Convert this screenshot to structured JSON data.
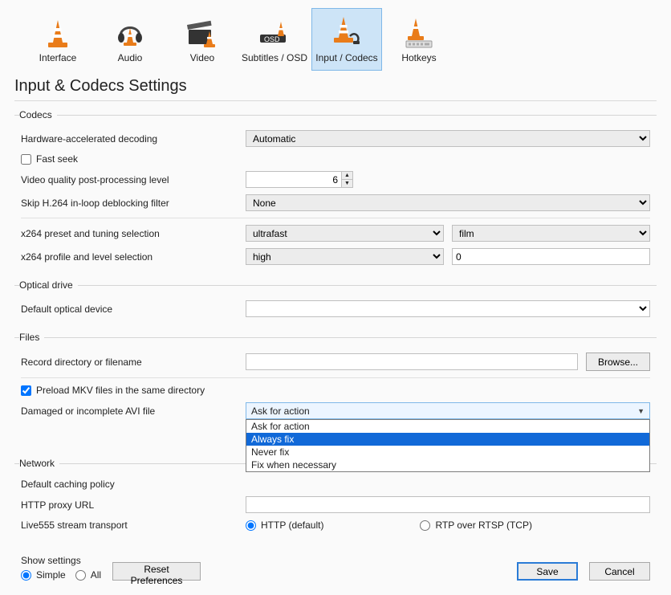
{
  "tabs": {
    "interface": "Interface",
    "audio": "Audio",
    "video": "Video",
    "subtitles": "Subtitles / OSD",
    "input_codecs": "Input / Codecs",
    "hotkeys": "Hotkeys"
  },
  "page_title": "Input & Codecs Settings",
  "groups": {
    "codecs": {
      "legend": "Codecs",
      "hw_decoding_label": "Hardware-accelerated decoding",
      "hw_decoding_value": "Automatic",
      "fast_seek_label": "Fast seek",
      "fast_seek_checked": false,
      "postproc_label": "Video quality post-processing level",
      "postproc_value": "6",
      "skip_h264_label": "Skip H.264 in-loop deblocking filter",
      "skip_h264_value": "None",
      "x264_preset_label": "x264 preset and tuning selection",
      "x264_preset_value": "ultrafast",
      "x264_tune_value": "film",
      "x264_profile_label": "x264 profile and level selection",
      "x264_profile_value": "high",
      "x264_level_value": "0"
    },
    "optical": {
      "legend": "Optical drive",
      "default_device_label": "Default optical device",
      "default_device_value": ""
    },
    "files": {
      "legend": "Files",
      "record_dir_label": "Record directory or filename",
      "record_dir_value": "",
      "browse_label": "Browse...",
      "preload_mkv_label": "Preload MKV files in the same directory",
      "preload_mkv_checked": true,
      "avi_label": "Damaged or incomplete AVI file",
      "avi_selected": "Ask for action",
      "avi_options": [
        "Ask for action",
        "Always fix",
        "Never fix",
        "Fix when necessary"
      ],
      "avi_highlighted_index": 1
    },
    "network": {
      "legend": "Network",
      "caching_label": "Default caching policy",
      "caching_value": "",
      "proxy_label": "HTTP proxy URL",
      "proxy_value": "",
      "live555_label": "Live555 stream transport",
      "live555_http": "HTTP (default)",
      "live555_rtp": "RTP over RTSP (TCP)",
      "live555_selected": "http"
    }
  },
  "footer": {
    "show_settings_label": "Show settings",
    "simple_label": "Simple",
    "all_label": "All",
    "mode_selected": "simple",
    "reset_label": "Reset Preferences",
    "save_label": "Save",
    "cancel_label": "Cancel"
  },
  "icon_names": {
    "interface": "cone-interface-icon",
    "audio": "headphones-cone-icon",
    "video": "clapboard-cone-icon",
    "subtitles": "letters-cone-icon",
    "input_codecs": "plug-cone-icon",
    "hotkeys": "keyboard-cone-icon"
  }
}
